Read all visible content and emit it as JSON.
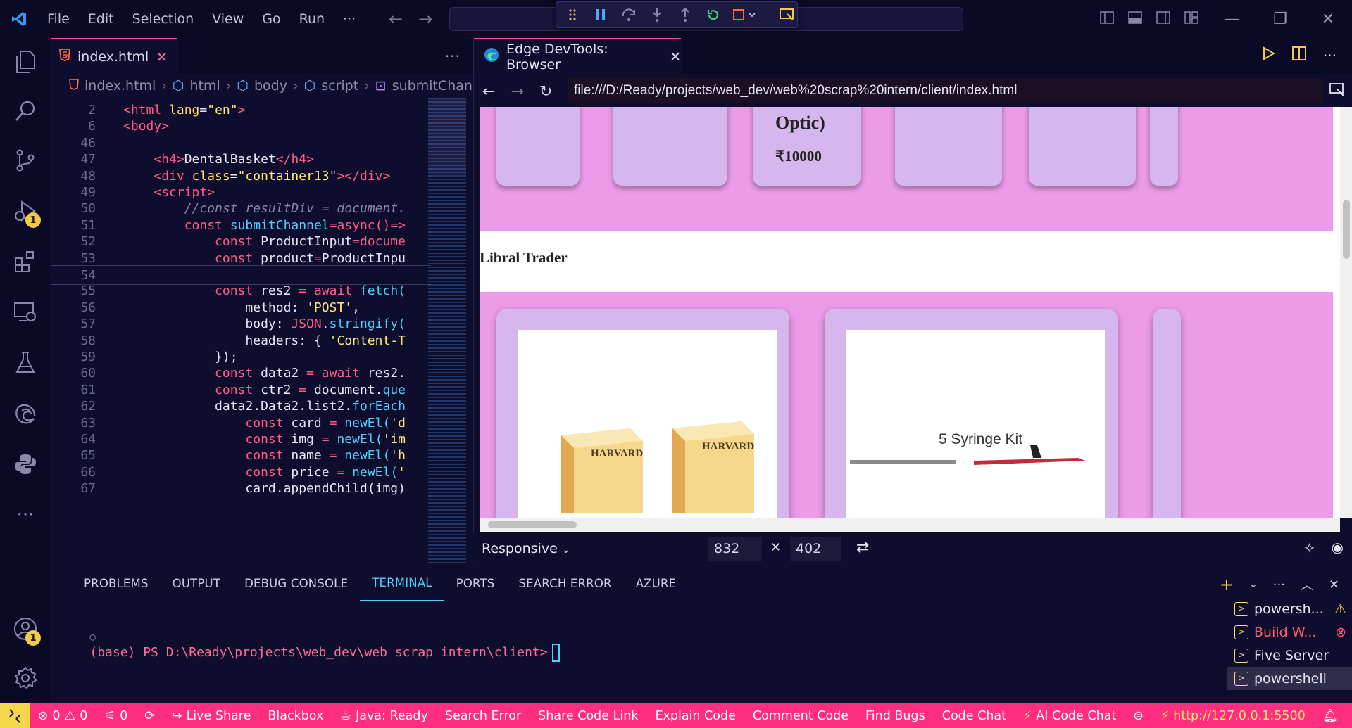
{
  "titlebar": {
    "menu": [
      "File",
      "Edit",
      "Selection",
      "View",
      "Go",
      "Run",
      "···"
    ]
  },
  "editor": {
    "tab_label": "index.html",
    "more": "···",
    "breadcrumb": [
      "index.html",
      "html",
      "body",
      "script",
      "submitChann"
    ],
    "lines": [
      {
        "n": "2",
        "tokens": [
          [
            "tag",
            "<html "
          ],
          [
            "attr",
            "lang"
          ],
          [
            "plain",
            "="
          ],
          [
            "str",
            "\"en\""
          ],
          [
            "tag",
            ">"
          ]
        ]
      },
      {
        "n": "6",
        "tokens": [
          [
            "tag",
            "<body>"
          ]
        ]
      },
      {
        "n": "46",
        "tokens": []
      },
      {
        "n": "47",
        "tokens": [
          [
            "plain",
            "    "
          ],
          [
            "tag",
            "<h4>"
          ],
          [
            "plain",
            "DentalBasket"
          ],
          [
            "tag",
            "</h4>"
          ]
        ]
      },
      {
        "n": "48",
        "tokens": [
          [
            "plain",
            "    "
          ],
          [
            "tag",
            "<div "
          ],
          [
            "attr",
            "class"
          ],
          [
            "plain",
            "="
          ],
          [
            "str",
            "\"container13\""
          ],
          [
            "tag",
            "></div>"
          ]
        ]
      },
      {
        "n": "49",
        "tokens": [
          [
            "plain",
            "    "
          ],
          [
            "tag",
            "<script>"
          ]
        ]
      },
      {
        "n": "50",
        "tokens": [
          [
            "plain",
            "        "
          ],
          [
            "comment",
            "//const resultDiv = document."
          ]
        ]
      },
      {
        "n": "51",
        "tokens": [
          [
            "plain",
            "        "
          ],
          [
            "kw",
            "const "
          ],
          [
            "fn",
            "submitChannel"
          ],
          [
            "kw",
            "=async()=>"
          ]
        ]
      },
      {
        "n": "52",
        "tokens": [
          [
            "plain",
            "            "
          ],
          [
            "kw",
            "const "
          ],
          [
            "plain",
            "ProductInput"
          ],
          [
            "kw",
            "=docume"
          ]
        ]
      },
      {
        "n": "53",
        "tokens": [
          [
            "plain",
            "            "
          ],
          [
            "kw",
            "const "
          ],
          [
            "plain",
            "product"
          ],
          [
            "kw",
            "="
          ],
          [
            "plain",
            "ProductInpu"
          ]
        ]
      },
      {
        "n": "54",
        "tokens": []
      },
      {
        "n": "55",
        "tokens": [
          [
            "plain",
            "            "
          ],
          [
            "kw",
            "const "
          ],
          [
            "plain",
            "res2 "
          ],
          [
            "kw",
            "= await "
          ],
          [
            "fn",
            "fetch("
          ]
        ]
      },
      {
        "n": "56",
        "tokens": [
          [
            "plain",
            "                method: "
          ],
          [
            "str",
            "'POST'"
          ],
          [
            "plain",
            ","
          ]
        ]
      },
      {
        "n": "57",
        "tokens": [
          [
            "plain",
            "                body: "
          ],
          [
            "kw",
            "JSON"
          ],
          [
            "plain",
            "."
          ],
          [
            "fn",
            "stringify("
          ]
        ]
      },
      {
        "n": "58",
        "tokens": [
          [
            "plain",
            "                headers: { "
          ],
          [
            "str",
            "'Content-T"
          ]
        ]
      },
      {
        "n": "59",
        "tokens": [
          [
            "plain",
            "            });"
          ]
        ]
      },
      {
        "n": "60",
        "tokens": [
          [
            "plain",
            "            "
          ],
          [
            "kw",
            "const "
          ],
          [
            "plain",
            "data2 "
          ],
          [
            "kw",
            "= await "
          ],
          [
            "plain",
            "res2."
          ]
        ]
      },
      {
        "n": "61",
        "tokens": [
          [
            "plain",
            "            "
          ],
          [
            "kw",
            "const "
          ],
          [
            "plain",
            "ctr2 "
          ],
          [
            "kw",
            "= "
          ],
          [
            "plain",
            "document."
          ],
          [
            "fn",
            "que"
          ]
        ]
      },
      {
        "n": "62",
        "tokens": [
          [
            "plain",
            "            data2.Data2.list2."
          ],
          [
            "fn",
            "forEach"
          ]
        ]
      },
      {
        "n": "63",
        "tokens": [
          [
            "plain",
            "                "
          ],
          [
            "kw",
            "const "
          ],
          [
            "plain",
            "card "
          ],
          [
            "kw",
            "= "
          ],
          [
            "fn",
            "newEl("
          ],
          [
            "str",
            "'d"
          ]
        ]
      },
      {
        "n": "64",
        "tokens": [
          [
            "plain",
            "                "
          ],
          [
            "kw",
            "const "
          ],
          [
            "plain",
            "img "
          ],
          [
            "kw",
            "= "
          ],
          [
            "fn",
            "newEl("
          ],
          [
            "str",
            "'im"
          ]
        ]
      },
      {
        "n": "65",
        "tokens": [
          [
            "plain",
            "                "
          ],
          [
            "kw",
            "const "
          ],
          [
            "plain",
            "name "
          ],
          [
            "kw",
            "= "
          ],
          [
            "fn",
            "newEl("
          ],
          [
            "str",
            "'h"
          ]
        ]
      },
      {
        "n": "66",
        "tokens": [
          [
            "plain",
            "                "
          ],
          [
            "kw",
            "const "
          ],
          [
            "plain",
            "price "
          ],
          [
            "kw",
            "= "
          ],
          [
            "fn",
            "newEl("
          ],
          [
            "str",
            "'"
          ]
        ]
      },
      {
        "n": "67",
        "tokens": [
          [
            "plain",
            "                card.appendChild(img)"
          ]
        ]
      }
    ]
  },
  "browser": {
    "tab_label": "Edge DevTools: Browser",
    "url": "file:///D:/Ready/projects/web_dev/web%20scrap%20intern/client/index.html",
    "page": {
      "card_title": "Optic)",
      "card_price": "₹10000",
      "section_title": "Libral Trader",
      "product1_brand": "HARVARD",
      "product2_label": "5 Syringe Kit"
    },
    "responsive": {
      "mode": "Responsive",
      "width": "832",
      "height": "402",
      "times": "✕"
    }
  },
  "panel": {
    "tabs": [
      "PROBLEMS",
      "OUTPUT",
      "DEBUG CONSOLE",
      "TERMINAL",
      "PORTS",
      "SEARCH ERROR",
      "AZURE"
    ],
    "active_tab": "TERMINAL",
    "terminal_prompt": "(base) PS D:\\Ready\\projects\\web_dev\\web scrap intern\\client>",
    "terminals": [
      {
        "label": "powersh...",
        "status": "warning"
      },
      {
        "label": "Build W...",
        "status": "error"
      },
      {
        "label": "Five Server",
        "status": ""
      },
      {
        "label": "powershell",
        "status": "active"
      }
    ]
  },
  "activity": {
    "debug_badge": "1",
    "account_badge": "1"
  },
  "statusbar": {
    "errors": "0",
    "warnings": "0",
    "ports": "0",
    "items": [
      "Live Share",
      "Blackbox",
      "Java: Ready",
      "Search Error",
      "Share Code Link",
      "Explain Code",
      "Comment Code",
      "Find Bugs",
      "Code Chat"
    ],
    "ai_chat": "AI Code Chat",
    "server_url": "http://127.0.0.1:5500"
  },
  "colors": {
    "accent": "#ff2e7e",
    "page_band": "#ec9be8",
    "card": "#d5b7ee",
    "terminal_active": "#4fd1ff"
  }
}
